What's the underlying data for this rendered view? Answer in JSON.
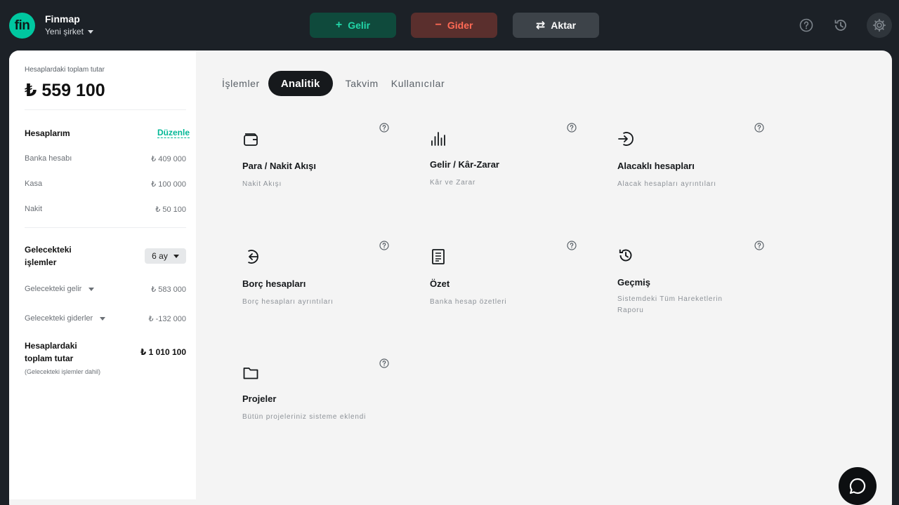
{
  "header": {
    "logo_text": "fin",
    "brand": "Finmap",
    "company": "Yeni şirket",
    "buttons": {
      "income": {
        "symbol": "+",
        "label": "Gelir"
      },
      "expense": {
        "symbol": "−",
        "label": "Gider"
      },
      "transfer": {
        "symbol": "⇄",
        "label": "Aktar"
      }
    },
    "icons": [
      "help-icon",
      "history-icon",
      "settings-icon"
    ]
  },
  "sidebar": {
    "total_label": "Hesaplardaki toplam tutar",
    "total_amount": "₺ 559 100",
    "accounts_title": "Hesaplarım",
    "edit_label": "Düzenle",
    "accounts": [
      {
        "name": "Banka hesabı",
        "value": "₺ 409 000"
      },
      {
        "name": "Kasa",
        "value": "₺ 100 000"
      },
      {
        "name": "Nakit",
        "value": "₺ 50 100"
      }
    ],
    "future_title_line1": "Gelecekteki",
    "future_title_line2": "işlemler",
    "period": "6 ay",
    "future_income_label": "Gelecekteki gelir",
    "future_income_value": "₺ 583 000",
    "future_expense_label": "Gelecekteki giderler",
    "future_expense_value": "₺ -132 000",
    "grand_total_line1": "Hesaplardaki",
    "grand_total_line2": "toplam tutar",
    "grand_total_value": "₺ 1 010 100",
    "grand_total_note": "(Gelecekteki işlemler dahil)"
  },
  "tabs": [
    {
      "label": "İşlemler",
      "active": false
    },
    {
      "label": "Analitik",
      "active": true
    },
    {
      "label": "Takvim",
      "active": false
    },
    {
      "label": "Kullanıcılar",
      "active": false
    }
  ],
  "cards": [
    {
      "title": "Para / Nakit Akışı",
      "subtitle": "Nakit Akışı",
      "icon": "wallet-icon"
    },
    {
      "title": "Gelir / Kâr-Zarar",
      "subtitle": "Kâr ve Zarar",
      "icon": "bar-chart-icon"
    },
    {
      "title": "Alacaklı hesapları",
      "subtitle": "Alacak hesapları ayrıntıları",
      "icon": "arrow-in-icon"
    },
    {
      "title": "Borç hesapları",
      "subtitle": "Borç hesapları ayrıntıları",
      "icon": "arrow-out-icon"
    },
    {
      "title": "Özet",
      "subtitle": "Banka hesap özetleri",
      "icon": "document-icon"
    },
    {
      "title": "Geçmiş",
      "subtitle": "Sistemdeki Tüm Hareketlerin Raporu",
      "icon": "history-icon"
    },
    {
      "title": "Projeler",
      "subtitle": "Bütün projeleriniz sisteme eklendi",
      "icon": "folder-icon"
    }
  ],
  "colors": {
    "accent": "#00c7a0",
    "income": "#22d6a8",
    "expense": "#ff6a55",
    "background": "#1c2127"
  }
}
